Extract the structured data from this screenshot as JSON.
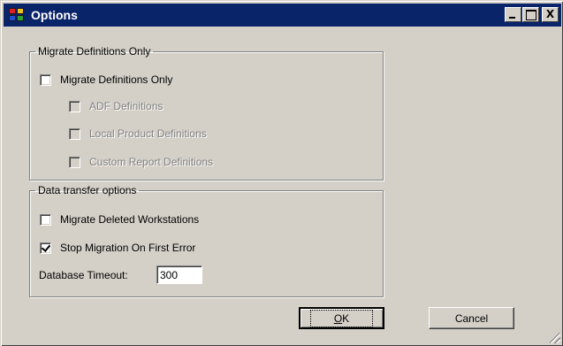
{
  "window": {
    "title": "Options",
    "icon": "options-app-icon",
    "buttons": {
      "minimize": "minimize-icon",
      "maximize": "maximize-icon",
      "close_label": "X"
    }
  },
  "groups": {
    "migrate_definitions": {
      "legend": "Migrate Definitions Only",
      "main_checkbox": {
        "label": "Migrate Definitions Only",
        "checked": false,
        "enabled": true
      },
      "sub_checkboxes": [
        {
          "label": "ADF Definitions",
          "checked": false,
          "enabled": false
        },
        {
          "label": "Local Product Definitions",
          "checked": false,
          "enabled": false
        },
        {
          "label": "Custom Report Definitions",
          "checked": false,
          "enabled": false
        }
      ]
    },
    "data_transfer": {
      "legend": "Data transfer options",
      "checkboxes": [
        {
          "label": "Migrate Deleted Workstations",
          "checked": false,
          "enabled": true
        },
        {
          "label": "Stop Migration On First Error",
          "checked": true,
          "enabled": true
        }
      ],
      "timeout": {
        "label": "Database Timeout:",
        "value": "300"
      }
    }
  },
  "footer": {
    "ok_mnemonic": "O",
    "ok_rest": "K",
    "cancel_label": "Cancel"
  },
  "colors": {
    "titlebar": "#0a246a",
    "dialog_face": "#d4d0c8"
  }
}
